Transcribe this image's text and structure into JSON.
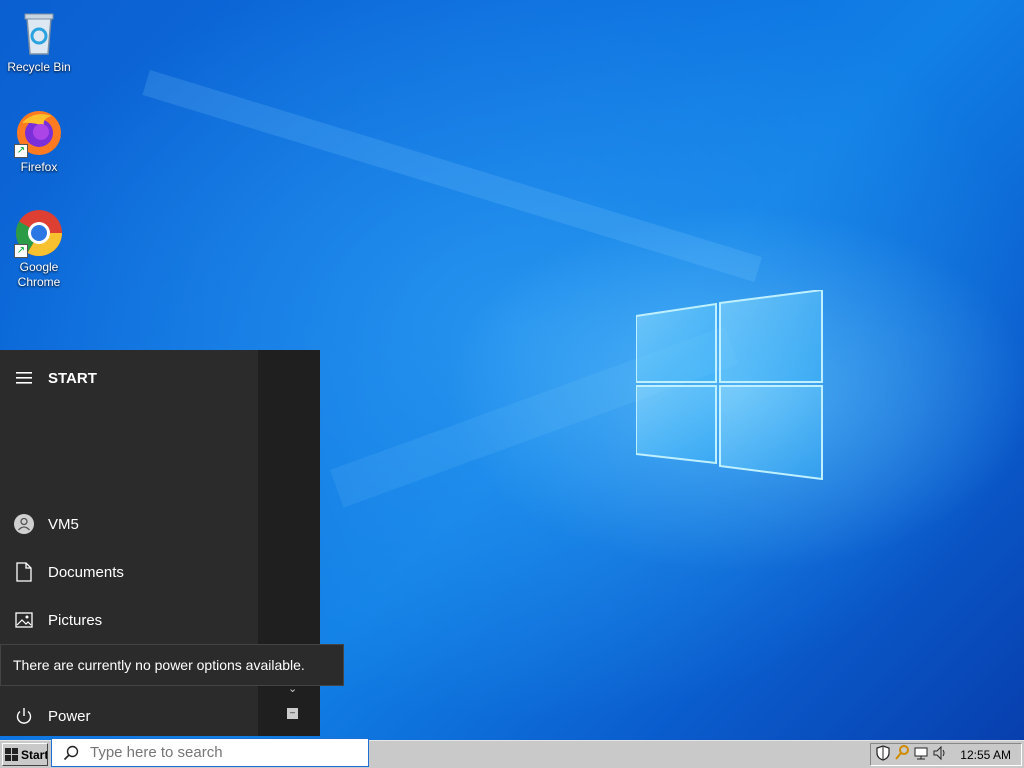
{
  "desktop": {
    "icons": [
      {
        "label": "Recycle Bin",
        "icon": "recycle-bin-icon"
      },
      {
        "label": "Firefox",
        "icon": "firefox-icon"
      },
      {
        "label_line1": "Google",
        "label_line2": "Chrome",
        "icon": "chrome-icon"
      }
    ]
  },
  "start_menu": {
    "title": "START",
    "items": [
      {
        "label": "VM5",
        "icon": "user-avatar-icon"
      },
      {
        "label": "Documents",
        "icon": "document-icon"
      },
      {
        "label": "Pictures",
        "icon": "pictures-icon"
      },
      {
        "label": "Power",
        "icon": "power-icon"
      }
    ],
    "tooltip": "There are currently no power options available."
  },
  "taskbar": {
    "start_label": "Start",
    "search_placeholder": "Type here to search",
    "clock": "12:55 AM",
    "tray_icons": [
      "shield-icon",
      "key-icon",
      "network-icon",
      "volume-icon"
    ]
  },
  "colors": {
    "accent": "#0a5bcc",
    "menu_bg": "#2b2b2b",
    "taskbar_bg": "#c9c9c9"
  }
}
